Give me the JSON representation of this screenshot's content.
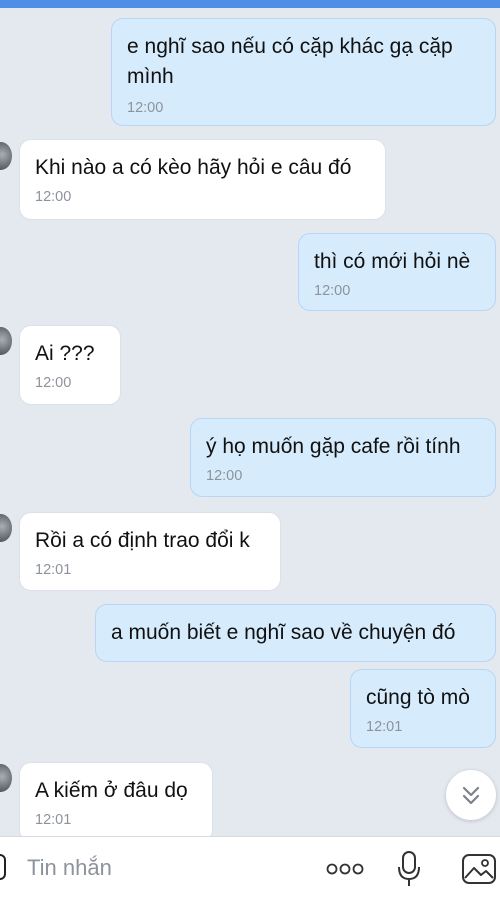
{
  "messages": [
    {
      "side": "out",
      "text": "e nghĩ sao nếu có cặp khác gạ cặp mình",
      "time": "12:00"
    },
    {
      "side": "in",
      "text": "Khi nào a có kèo hãy hỏi e câu đó",
      "time": "12:00"
    },
    {
      "side": "out",
      "text": "thì có mới hỏi nè",
      "time": "12:00"
    },
    {
      "side": "in",
      "text": "Ai ???",
      "time": "12:00"
    },
    {
      "side": "out",
      "text": "ý họ muốn gặp cafe rồi tính",
      "time": "12:00"
    },
    {
      "side": "in",
      "text": "Rồi a có định trao đổi k",
      "time": "12:01"
    },
    {
      "side": "out",
      "text": "a muốn biết e nghĩ sao về chuyện đó",
      "time": null
    },
    {
      "side": "out",
      "text": "cũng tò mò",
      "time": "12:01"
    },
    {
      "side": "in",
      "text": "A kiếm ở đâu dọ",
      "time": "12:01"
    }
  ],
  "composer": {
    "placeholder": "Tin nhắn",
    "icons": [
      "emoji-icon",
      "more-icon",
      "microphone-icon",
      "image-icon"
    ]
  },
  "scroll_button": {
    "icon": "double-chevron-down-icon"
  },
  "colors": {
    "background": "#e4e8ef",
    "outgoing_bubble": "#d6ecfd",
    "incoming_bubble": "#ffffff",
    "accent": "#4f8fe6"
  }
}
